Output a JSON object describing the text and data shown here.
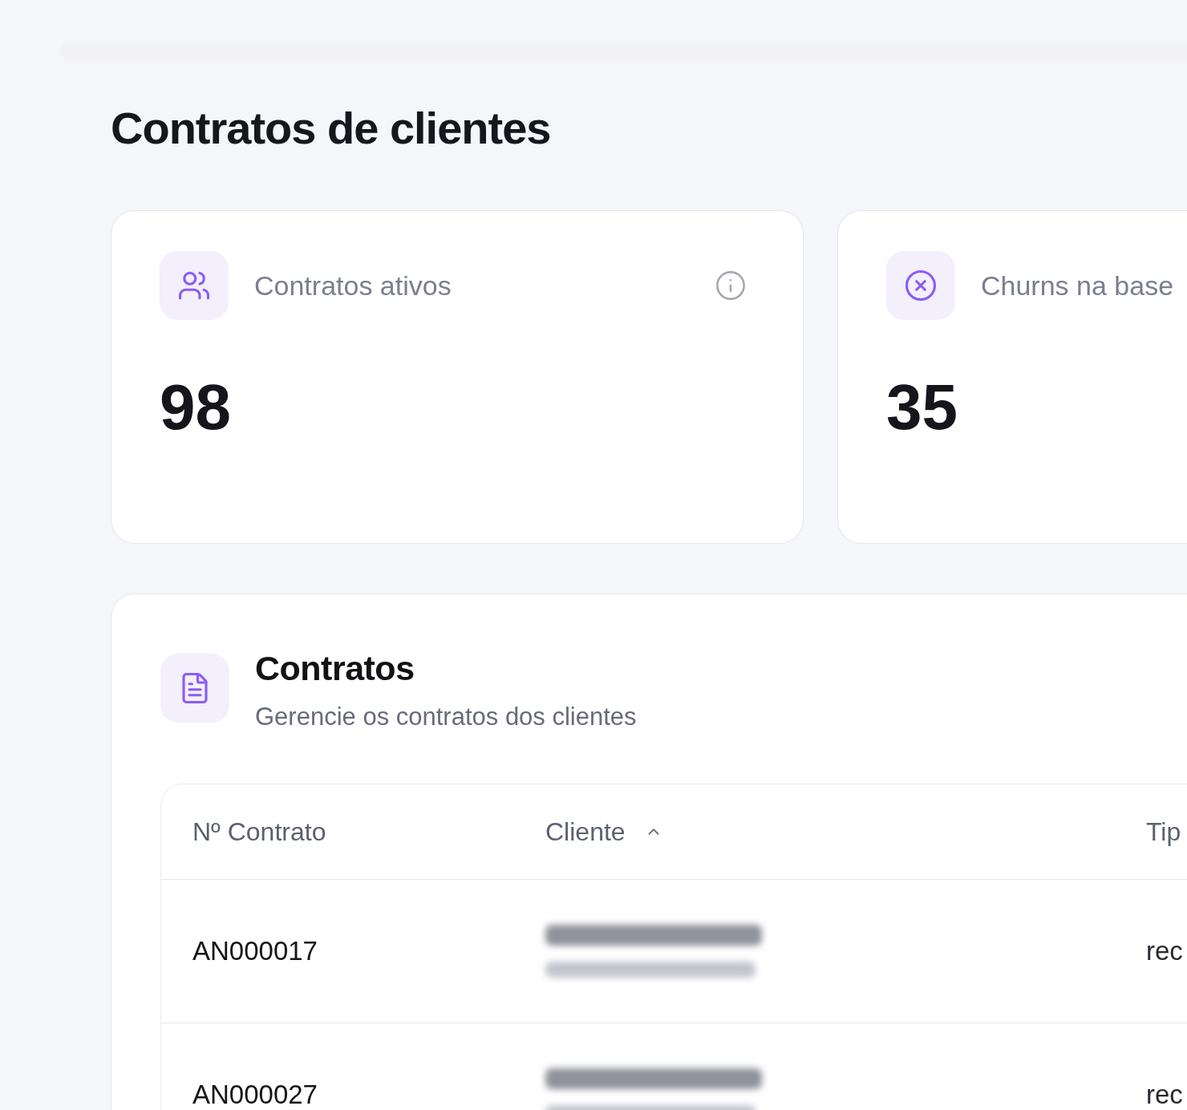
{
  "page": {
    "title": "Contratos de clientes"
  },
  "stats": [
    {
      "kind": "users",
      "label": "Contratos ativos",
      "value": "98",
      "info": true
    },
    {
      "kind": "churn",
      "label": "Churns na base",
      "value": "35"
    }
  ],
  "contracts": {
    "title": "Contratos",
    "subtitle": "Gerencie os contratos dos clientes",
    "table": {
      "columns": [
        {
          "label": "Nº Contrato",
          "sorted": false
        },
        {
          "label": "Cliente",
          "sorted": true
        },
        {
          "label": "Tip",
          "sorted": false
        }
      ],
      "rows": [
        {
          "contract": "AN000017",
          "client_redacted": true,
          "column_3": "rec"
        },
        {
          "contract": "AN000027",
          "client_redacted": true,
          "column_3": "rec"
        }
      ]
    }
  }
}
